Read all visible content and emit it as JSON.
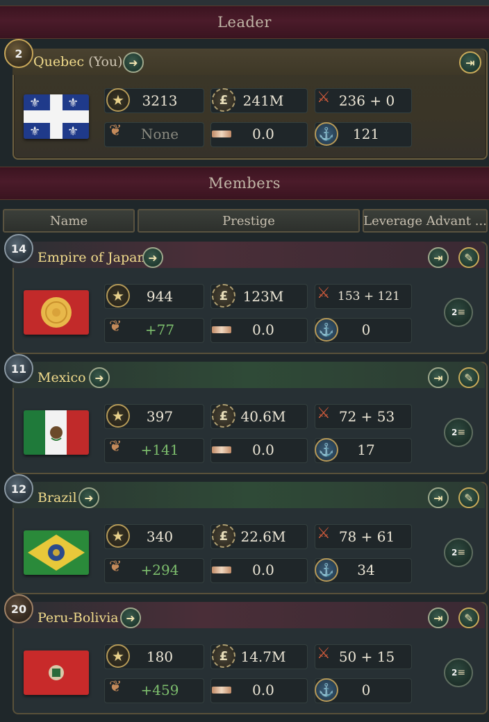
{
  "sections": {
    "leader_title": "Leader",
    "members_title": "Members"
  },
  "columns": {
    "name": "Name",
    "prestige": "Prestige",
    "leverage": "Leverage Advant ..."
  },
  "icons": {
    "prestige": "star-icon",
    "gdp": "pound-gear-icon",
    "army": "soldier-icon",
    "influence": "octopus-icon",
    "trade": "bar-icon",
    "navy": "anchor-icon",
    "goto": "arrow-right-icon",
    "diplomacy": "signpost-icon",
    "action": "handshake-icon",
    "leverage": "leverage-icon"
  },
  "leader": {
    "rank": "2",
    "name": "Quebec",
    "you_tag": "(You)",
    "prestige": "3213",
    "gdp": "241M",
    "army": "236 + 0",
    "influence": "None",
    "trade": "0.0",
    "navy": "121"
  },
  "members": [
    {
      "rank": "14",
      "name": "Empire of Japan",
      "prestige": "944",
      "gdp": "123M",
      "army": "153 + 121",
      "influence": "+77",
      "trade": "0.0",
      "navy": "0",
      "leverage": "2"
    },
    {
      "rank": "11",
      "name": "Mexico",
      "prestige": "397",
      "gdp": "40.6M",
      "army": "72 + 53",
      "influence": "+141",
      "trade": "0.0",
      "navy": "17",
      "leverage": "2"
    },
    {
      "rank": "12",
      "name": "Brazil",
      "prestige": "340",
      "gdp": "22.6M",
      "army": "78 + 61",
      "influence": "+294",
      "trade": "0.0",
      "navy": "34",
      "leverage": "2"
    },
    {
      "rank": "20",
      "name": "Peru-Bolivia",
      "prestige": "180",
      "gdp": "14.7M",
      "army": "50 + 15",
      "influence": "+459",
      "trade": "0.0",
      "navy": "0",
      "leverage": "2"
    }
  ],
  "colors": {
    "name_gold": "#f2dc8c",
    "positive_green": "#7ec06e",
    "header_burgundy": "#4b1b2a"
  }
}
